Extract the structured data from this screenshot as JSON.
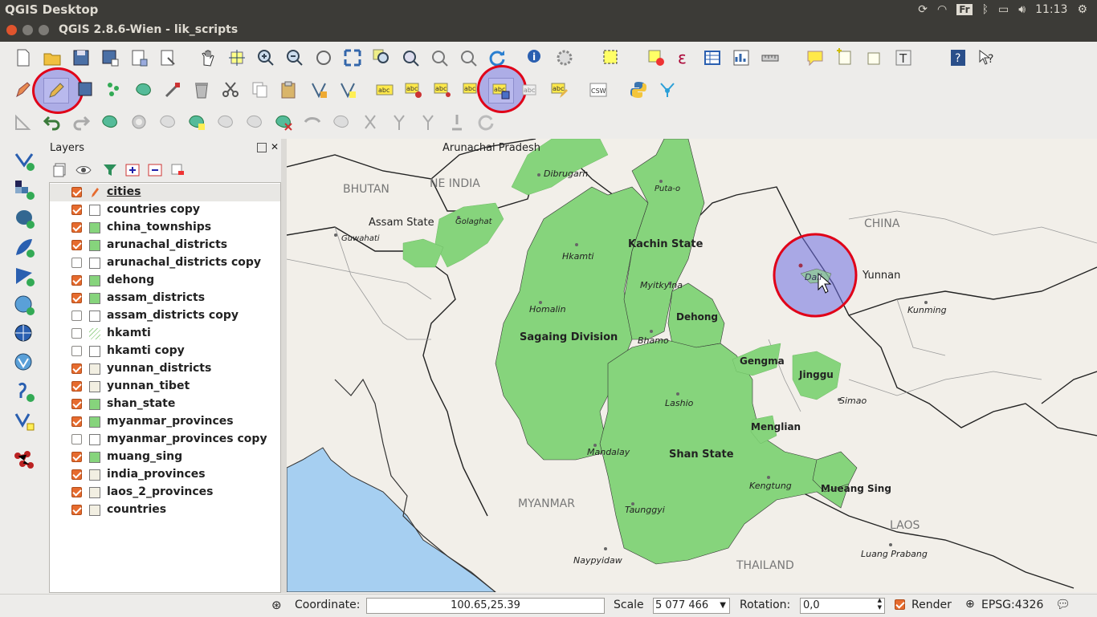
{
  "system": {
    "app_name": "QGIS Desktop",
    "keyboard_layout": "Fr",
    "clock": "11:13"
  },
  "window": {
    "title": "QGIS 2.8.6-Wien - lik_scripts"
  },
  "layers_panel": {
    "title": "Layers",
    "layers": [
      {
        "name": "cities",
        "checked": true,
        "symbol": "pencil",
        "editing": true
      },
      {
        "name": "countries copy",
        "checked": true,
        "symbol": "#ffffff"
      },
      {
        "name": "china_townships",
        "checked": true,
        "symbol": "#86d47c"
      },
      {
        "name": "arunachal_districts",
        "checked": true,
        "symbol": "#86d47c"
      },
      {
        "name": "arunachal_districts copy",
        "checked": false,
        "symbol": "#ffffff"
      },
      {
        "name": "dehong",
        "checked": true,
        "symbol": "#86d47c"
      },
      {
        "name": "assam_districts",
        "checked": true,
        "symbol": "#86d47c"
      },
      {
        "name": "assam_districts copy",
        "checked": false,
        "symbol": "#ffffff"
      },
      {
        "name": "hkamti",
        "checked": false,
        "symbol": "hatch"
      },
      {
        "name": "hkamti copy",
        "checked": false,
        "symbol": "#ffffff"
      },
      {
        "name": "yunnan_districts",
        "checked": true,
        "symbol": "#f2efe2"
      },
      {
        "name": "yunnan_tibet",
        "checked": true,
        "symbol": "#f2efe2"
      },
      {
        "name": "shan_state",
        "checked": true,
        "symbol": "#86d47c"
      },
      {
        "name": "myanmar_provinces",
        "checked": true,
        "symbol": "#86d47c"
      },
      {
        "name": "myanmar_provinces copy",
        "checked": false,
        "symbol": "#ffffff"
      },
      {
        "name": "muang_sing",
        "checked": true,
        "symbol": "#86d47c"
      },
      {
        "name": "india_provinces",
        "checked": true,
        "symbol": "#f2efe2"
      },
      {
        "name": "laos_2_provinces",
        "checked": true,
        "symbol": "#f2efe2"
      },
      {
        "name": "countries",
        "checked": true,
        "symbol": "#f2efe2"
      }
    ]
  },
  "map": {
    "labels": {
      "arunachal_pradesh": "Arunachal Pradesh",
      "bhutan": "BHUTAN",
      "ne_india": "NE INDIA",
      "dibrugarh": "Dibrugarh",
      "assam_state": "Assam State",
      "golaghat": "Golaghat",
      "guwahati": "Guwahati",
      "puta_o": "Puta-o",
      "kachin_state": "Kachin State",
      "china": "CHINA",
      "hkamti": "Hkamti",
      "myitkyina": "Myitkyina",
      "yunnan": "Yunnan",
      "kunming": "Kunming",
      "homalin": "Homalin",
      "dehong": "Dehong",
      "sagaing_division": "Sagaing Division",
      "bhamo": "Bhamo",
      "gengma": "Gengma",
      "jinggu": "Jinggu",
      "simao": "Simao",
      "lashio": "Lashio",
      "menglian": "Menglian",
      "mandalay": "Mandalay",
      "shan_state": "Shan State",
      "kengtung": "Kengtung",
      "mueang_sing": "Mueang Sing",
      "myanmar": "MYANMAR",
      "taunggyi": "Taunggyi",
      "laos": "LAOS",
      "luang_prabang": "Luang Prabang",
      "naypyidaw": "Naypyidaw",
      "thailand": "THAILAND",
      "dali": "Dali"
    }
  },
  "statusbar": {
    "coordinate_label": "Coordinate:",
    "coordinate_value": "100.65,25.39",
    "scale_label": "Scale",
    "scale_value": "5 077 466",
    "rotation_label": "Rotation:",
    "rotation_value": "0,0",
    "render_label": "Render",
    "render_checked": true,
    "crs": "EPSG:4326"
  },
  "colors": {
    "highlight_fill": "#6e6ee1",
    "highlight_ring": "#e00018",
    "region_green": "#86d47c",
    "sea": "#a6cff1",
    "land": "#f2efe9"
  }
}
